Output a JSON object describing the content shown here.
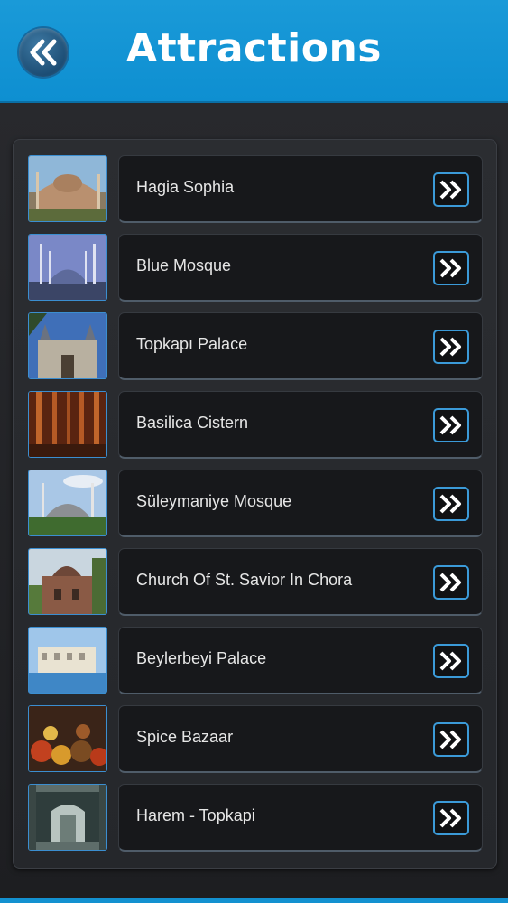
{
  "header": {
    "title": "Attractions",
    "back_icon": "double-chevron-left-icon"
  },
  "colors": {
    "header": "#1591d4",
    "accent": "#3b9ad8",
    "background": "#1e1f22"
  },
  "attractions": [
    {
      "label": "Hagia Sophia",
      "thumb": "hagia-sophia-thumbnail"
    },
    {
      "label": "Blue Mosque",
      "thumb": "blue-mosque-thumbnail"
    },
    {
      "label": "Topkapı Palace",
      "thumb": "topkapi-palace-thumbnail"
    },
    {
      "label": "Basilica Cistern",
      "thumb": "basilica-cistern-thumbnail"
    },
    {
      "label": "Süleymaniye Mosque",
      "thumb": "suleymaniye-mosque-thumbnail"
    },
    {
      "label": "Church Of St. Savior In Chora",
      "thumb": "chora-church-thumbnail"
    },
    {
      "label": "Beylerbeyi Palace",
      "thumb": "beylerbeyi-palace-thumbnail"
    },
    {
      "label": "Spice Bazaar",
      "thumb": "spice-bazaar-thumbnail"
    },
    {
      "label": "Harem - Topkapi",
      "thumb": "harem-topkapi-thumbnail"
    }
  ]
}
